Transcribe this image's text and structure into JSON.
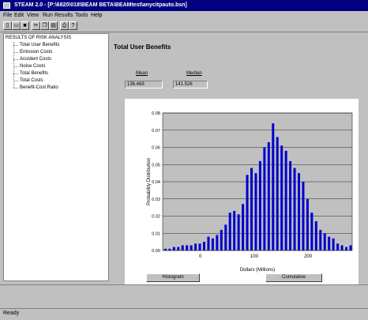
{
  "window": {
    "title": "STEAM 2.0 - [P:\\6820\\018\\BEAM BETA\\BEAMtest\\anycitpauto.bsn]"
  },
  "menu": [
    "File",
    "Edit",
    "View",
    "Run",
    "Results",
    "Tools",
    "Help"
  ],
  "toolbar": [
    {
      "icon": "new-file-icon",
      "glyph": "▯"
    },
    {
      "icon": "open-folder-icon",
      "glyph": "▭"
    },
    {
      "icon": "save-icon",
      "glyph": "■"
    },
    {
      "icon": "cut-icon",
      "glyph": "✂"
    },
    {
      "icon": "copy-icon",
      "glyph": "❐"
    },
    {
      "icon": "paste-icon",
      "glyph": "▤"
    },
    {
      "icon": "print-icon",
      "glyph": "⎙"
    },
    {
      "icon": "help-icon",
      "glyph": "?"
    }
  ],
  "tree": {
    "root": "RESULTS OF RISK ANALYSIS",
    "items": [
      "Total User Benefits",
      "Emission Costs",
      "Accident Costs",
      "Noise Costs",
      "Total Benefits",
      "Total Costs",
      "Benefit-Cost Ratio"
    ]
  },
  "main": {
    "title": "Total User Benefits",
    "mean_label": "Mean",
    "mean_value": "136.469",
    "median_label": "Median",
    "median_value": "141.526",
    "histogram_button": "Histogram",
    "cumulative_button": "Cumulative"
  },
  "status": {
    "text": "Ready"
  },
  "colors": {
    "bar": "#0000cc",
    "plot_bg": "#c0c0c0",
    "title_bar": "#000080"
  },
  "chart_data": {
    "type": "bar",
    "xlabel": "Dollars (Millions)",
    "ylabel": "Probability Distribution",
    "ylim": [
      0,
      0.08
    ],
    "xlim": [
      -70,
      282
    ],
    "yticks": [
      "0.00",
      "0.01",
      "0.02",
      "0.03",
      "0.04",
      "0.05",
      "0.06",
      "0.07",
      "0.08"
    ],
    "xticks": [
      {
        "value": 0,
        "label": "0"
      },
      {
        "value": 100,
        "label": "100"
      },
      {
        "value": 200,
        "label": "200"
      }
    ],
    "grid": true,
    "x": [
      -65,
      -57,
      -49,
      -41,
      -33,
      -25,
      -17,
      -9,
      -1,
      7,
      15,
      23,
      31,
      39,
      47,
      55,
      63,
      71,
      79,
      87,
      95,
      103,
      111,
      119,
      127,
      135,
      143,
      151,
      159,
      167,
      175,
      183,
      191,
      199,
      207,
      215,
      223,
      231,
      239,
      247,
      255,
      263,
      271,
      279
    ],
    "values": [
      0.001,
      0.001,
      0.002,
      0.002,
      0.003,
      0.003,
      0.003,
      0.004,
      0.004,
      0.005,
      0.008,
      0.007,
      0.009,
      0.012,
      0.015,
      0.022,
      0.023,
      0.021,
      0.027,
      0.044,
      0.048,
      0.045,
      0.052,
      0.06,
      0.063,
      0.074,
      0.066,
      0.061,
      0.058,
      0.052,
      0.048,
      0.045,
      0.04,
      0.03,
      0.022,
      0.017,
      0.012,
      0.01,
      0.008,
      0.007,
      0.004,
      0.003,
      0.002,
      0.003
    ]
  }
}
